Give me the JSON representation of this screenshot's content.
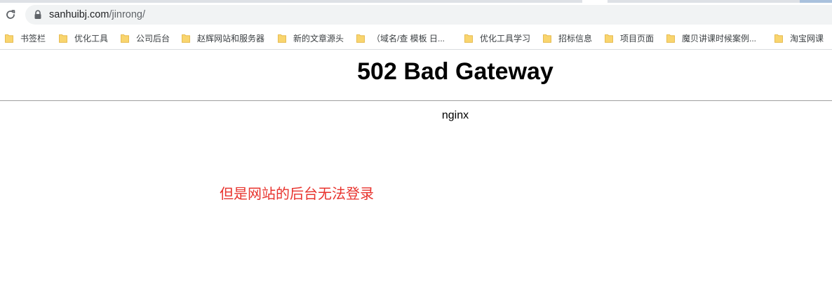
{
  "browser": {
    "address_bar": {
      "host": "sanhuibj.com",
      "path": "/jinrong/"
    },
    "bookmarks": [
      {
        "label": "书签栏",
        "icon": "folder-icon"
      },
      {
        "label": "优化工具",
        "icon": "folder-icon"
      },
      {
        "label": "公司后台",
        "icon": "folder-icon"
      },
      {
        "label": "赵辉网站和服务器",
        "icon": "folder-icon"
      },
      {
        "label": "新的文章源头",
        "icon": "folder-icon"
      },
      {
        "label": "（域名/查 模板 日...",
        "icon": "folder-icon"
      },
      {
        "label": "优化工具学习",
        "icon": "folder-icon"
      },
      {
        "label": "招标信息",
        "icon": "folder-icon"
      },
      {
        "label": "项目页面",
        "icon": "folder-icon"
      },
      {
        "label": "魔贝讲课时候案例...",
        "icon": "folder-icon"
      },
      {
        "label": "淘宝网课",
        "icon": "folder-icon"
      }
    ],
    "folder_color": "#f9d56e"
  },
  "page": {
    "title": "502 Bad Gateway",
    "server": "nginx"
  },
  "annotation": {
    "text": "但是网站的后台无法登录",
    "color": "#e8332d"
  }
}
